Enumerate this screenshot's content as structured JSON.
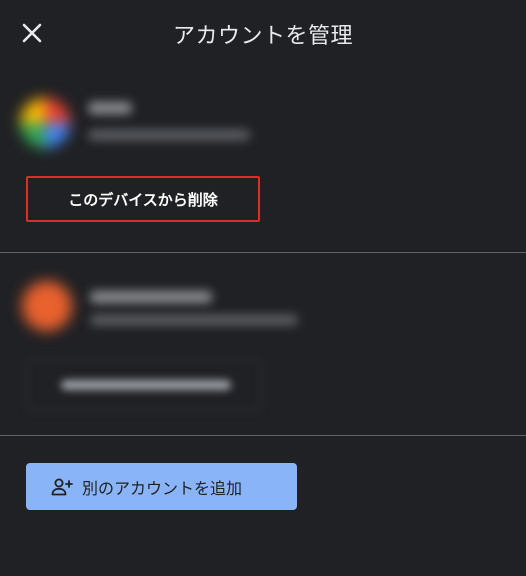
{
  "header": {
    "title": "アカウントを管理",
    "close_icon": "close-icon"
  },
  "accounts": [
    {
      "avatar": "google-avatar",
      "action_label": "このデバイスから削除",
      "action_border_color": "#d93025"
    },
    {
      "avatar": "orange-avatar"
    }
  ],
  "footer": {
    "add_account_label": "別のアカウントを追加",
    "add_account_icon": "add-person-icon",
    "add_button_color": "#8ab4f8"
  }
}
